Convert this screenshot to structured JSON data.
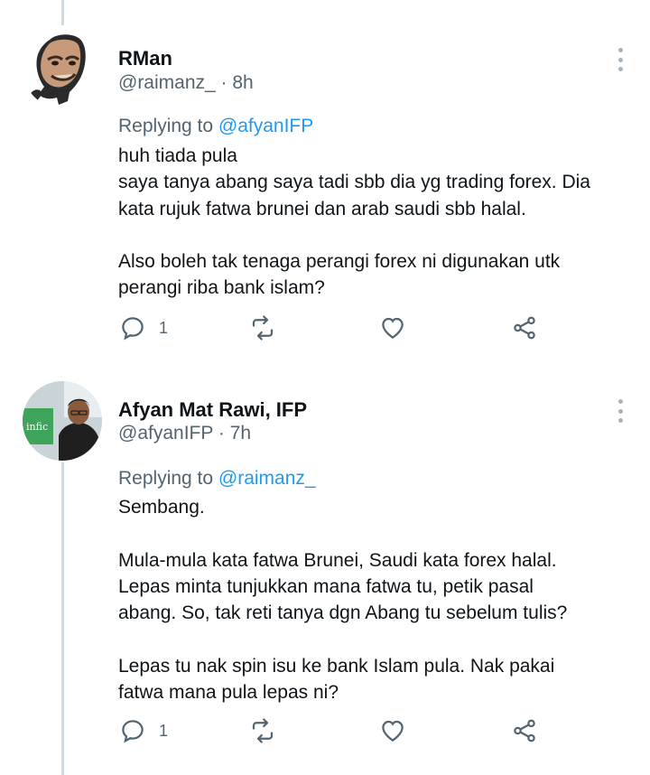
{
  "tweets": [
    {
      "name": "RMan",
      "handle": "@raimanz_",
      "time": "· 8h",
      "replying_prefix": "Replying to ",
      "replying_to": "@afyanIFP",
      "paragraphs": [
        [
          "huh tiada pula",
          "saya tanya abang saya tadi sbb dia yg trading forex. Dia",
          "kata rujuk fatwa brunei dan arab saudi sbb halal."
        ],
        [
          "Also boleh tak tenaga perangi forex ni digunakan utk",
          "perangi riba bank islam?"
        ]
      ],
      "reply_count": "1"
    },
    {
      "name": "Afyan Mat Rawi, IFP",
      "handle": "@afyanIFP",
      "time": "· 7h",
      "replying_prefix": "Replying to ",
      "replying_to": "@raimanz_",
      "paragraphs": [
        [
          "Sembang."
        ],
        [
          "Mula-mula kata fatwa Brunei, Saudi kata forex halal.",
          "Lepas minta tunjukkan mana fatwa tu, petik pasal",
          "abang. So, tak reti tanya dgn Abang tu sebelum tulis?"
        ],
        [
          "Lepas tu nak spin isu ke bank Islam pula. Nak pakai",
          "fatwa mana pula lepas ni?"
        ]
      ],
      "reply_count": "1",
      "avatar_badge": "infic"
    }
  ],
  "icons": {
    "reply": "reply-icon",
    "retweet": "retweet-icon",
    "like": "heart-icon",
    "share": "share-icon",
    "more": "more-icon"
  },
  "colors": {
    "text": "#0f1419",
    "secondary": "#536471",
    "link": "#1d9bf0",
    "thread_line": "#cfd9de"
  }
}
